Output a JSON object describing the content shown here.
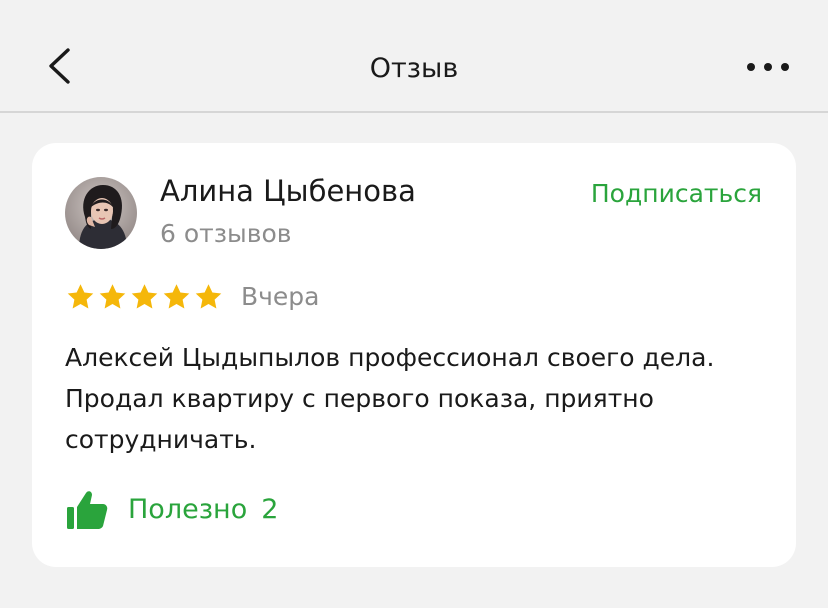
{
  "header": {
    "title": "Отзыв",
    "back_icon": "chevron-left-icon",
    "more_icon": "more-horizontal-icon"
  },
  "review": {
    "author": {
      "name": "Алина Цыбенова",
      "reviews_count": "6 отзывов"
    },
    "subscribe_label": "Подписаться",
    "rating": 5,
    "rating_max": 5,
    "date": "Вчера",
    "text": "Алексей Цыдыпылов профессионал своего дела. Продал квартиру с первого показа, приятно сотрудничать.",
    "useful": {
      "label": "Полезно",
      "count": "2",
      "icon": "thumbs-up-icon"
    }
  },
  "colors": {
    "accent_green": "#2aa43c",
    "star_yellow": "#f5b70a",
    "secondary_text": "#8c8c8c",
    "background": "#f2f2f2",
    "card": "#ffffff"
  }
}
